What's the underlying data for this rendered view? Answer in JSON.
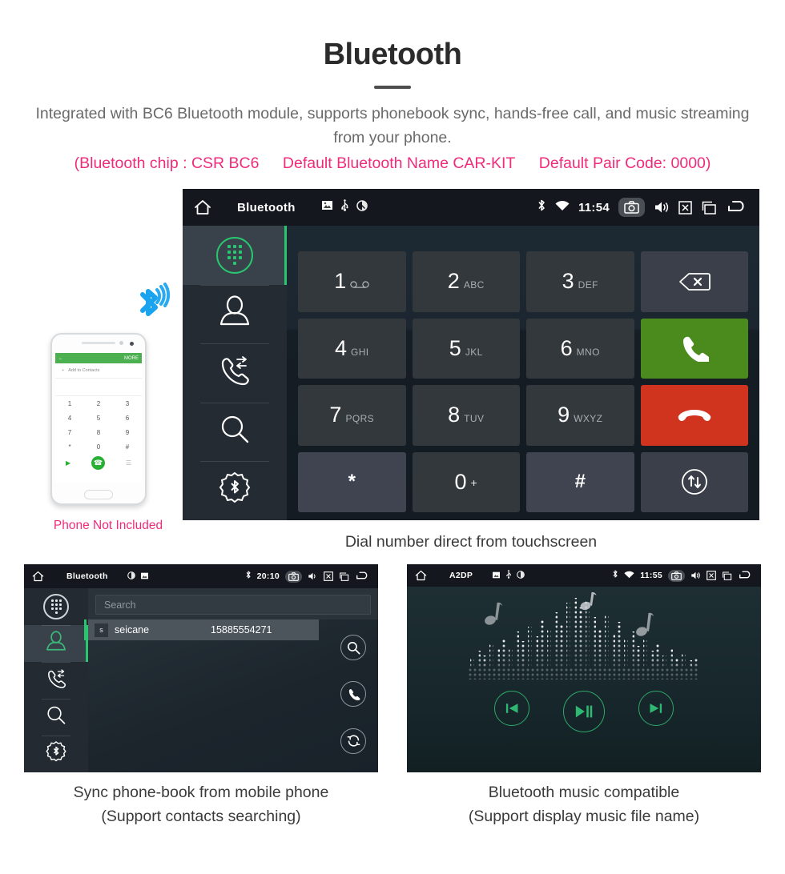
{
  "header": {
    "title": "Bluetooth",
    "subtitle": "Integrated with BC6 Bluetooth module, supports phonebook sync, hands-free call, and music streaming from your phone.",
    "spec_open": "(Bluetooth chip : CSR BC6",
    "spec_name": "Default Bluetooth Name CAR-KIT",
    "spec_code": "Default Pair Code: 0000)",
    "accent_pink": "#ef2b7b",
    "accent_green": "#28c76f"
  },
  "dialer": {
    "statusbar": {
      "title": "Bluetooth",
      "time": "11:54",
      "icons_left": [
        "home-icon",
        "sdcard-icon",
        "usb-icon",
        "mute-icon"
      ],
      "icons_right": [
        "bluetooth-icon",
        "wifi-icon",
        "camera-icon",
        "volume-icon",
        "close-icon",
        "recents-icon",
        "back-icon"
      ]
    },
    "sidebar": [
      {
        "name": "dialpad",
        "label": "Dialpad",
        "active": true
      },
      {
        "name": "contacts",
        "label": "Contacts",
        "active": false
      },
      {
        "name": "call-history",
        "label": "Call History",
        "active": false
      },
      {
        "name": "search",
        "label": "Search",
        "active": false
      },
      {
        "name": "bluetooth-settings",
        "label": "Bluetooth Settings",
        "active": false
      }
    ],
    "number_value": "",
    "keys": [
      {
        "num": "1",
        "ltr": "",
        "icon": "voicemail"
      },
      {
        "num": "2",
        "ltr": "ABC"
      },
      {
        "num": "3",
        "ltr": "DEF"
      },
      {
        "num": "4",
        "ltr": "GHI"
      },
      {
        "num": "5",
        "ltr": "JKL"
      },
      {
        "num": "6",
        "ltr": "MNO"
      },
      {
        "num": "7",
        "ltr": "PQRS"
      },
      {
        "num": "8",
        "ltr": "TUV"
      },
      {
        "num": "9",
        "ltr": "WXYZ"
      },
      {
        "num": "*",
        "ltr": ""
      },
      {
        "num": "0",
        "ltr": "+"
      },
      {
        "num": "#",
        "ltr": ""
      }
    ],
    "actions": [
      {
        "name": "backspace",
        "label": "Delete",
        "color": "#3a3f49"
      },
      {
        "name": "call",
        "label": "Call",
        "color": "#4b8b1e"
      },
      {
        "name": "hangup",
        "label": "Hang Up",
        "color": "#d0341f"
      },
      {
        "name": "transfer-audio",
        "label": "Transfer Audio",
        "color": "#3a3f49"
      }
    ],
    "caption": "Dial number direct from touchscreen"
  },
  "phone_illustration": {
    "screen_bar_back": "←",
    "screen_bar_more": "MORE",
    "add_plus": "+",
    "add_label": "Add to Contacts",
    "keys": [
      "1",
      "2",
      "3",
      "4",
      "5",
      "6",
      "7",
      "8",
      "9",
      "*",
      "0",
      "#"
    ],
    "caption": "Phone Not Included"
  },
  "phonebook": {
    "statusbar": {
      "title": "Bluetooth",
      "time": "20:10"
    },
    "sidebar": [
      {
        "name": "dialpad",
        "label": "Dialpad",
        "active": false
      },
      {
        "name": "contacts",
        "label": "Contacts",
        "active": true
      },
      {
        "name": "call-history",
        "label": "Call History",
        "active": false
      },
      {
        "name": "search",
        "label": "Search",
        "active": false
      },
      {
        "name": "bluetooth-settings",
        "label": "Bluetooth Settings",
        "active": false
      }
    ],
    "search_placeholder": "Search",
    "search_value": "",
    "contacts": [
      {
        "initial": "s",
        "name": "seicane",
        "number": "15885554271"
      }
    ],
    "actions": [
      {
        "name": "search",
        "label": "Search"
      },
      {
        "name": "call",
        "label": "Call"
      },
      {
        "name": "sync",
        "label": "Sync"
      }
    ],
    "caption_line1": "Sync phone-book from mobile phone",
    "caption_line2": "(Support contacts searching)"
  },
  "music": {
    "statusbar": {
      "title": "A2DP",
      "time": "11:55"
    },
    "controls": [
      {
        "name": "previous",
        "label": "Previous"
      },
      {
        "name": "play-pause",
        "label": "Play / Pause"
      },
      {
        "name": "next",
        "label": "Next"
      }
    ],
    "caption_line1": "Bluetooth music compatible",
    "caption_line2": "(Support display music file name)"
  }
}
